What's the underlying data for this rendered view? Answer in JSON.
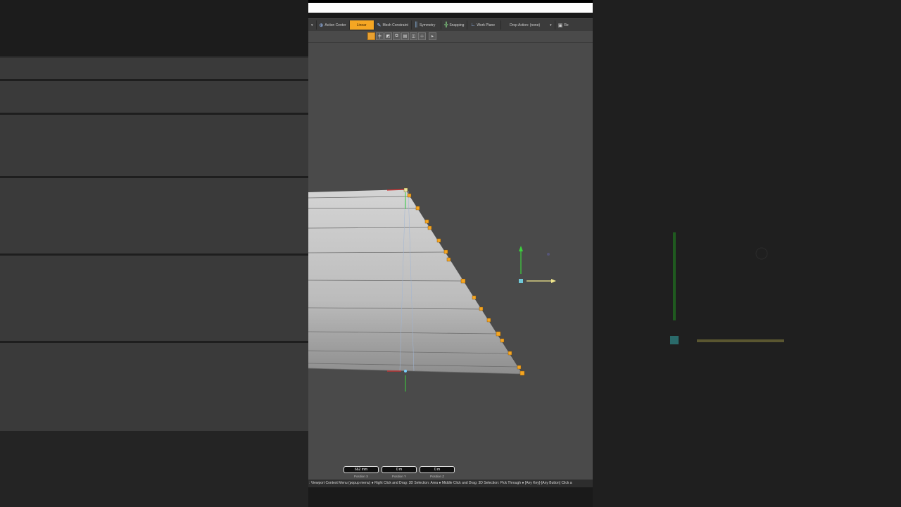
{
  "toolbar": {
    "items": [
      {
        "label": "Action Center",
        "icon": "action-center-icon"
      },
      {
        "label": "Linear",
        "icon": "",
        "active": true
      },
      {
        "label": "Mesh Constraint",
        "icon": "mesh-constraint-icon"
      },
      {
        "label": "Symmetry",
        "icon": "symmetry-icon"
      },
      {
        "label": "Snapping",
        "icon": "snapping-icon"
      },
      {
        "label": "Work Plane",
        "icon": "work-plane-icon"
      },
      {
        "label": "Drop Action: (none)",
        "icon": ""
      },
      {
        "label": "Re",
        "icon": "render-icon"
      }
    ],
    "accent": "#f5a623"
  },
  "fields": [
    {
      "value": "662 mm",
      "label": "Position X"
    },
    {
      "value": "0 m",
      "label": "Position Y"
    },
    {
      "value": "0 m",
      "label": "Position Z"
    }
  ],
  "status": {
    "text": ": Viewport Context Menu (popup menu) ● Right Click and Drag: 3D Selection: Area ● Middle Click and Drag: 3D Selection: Pick Through ● [Any Key]-[Any Button] Click a"
  },
  "colors": {
    "viewport_bg": "#4a4a4a",
    "mesh": "#c8c8c8",
    "vertex": "#f5a623",
    "axis_y": "#3cd23c",
    "axis_x": "#f0e68c"
  }
}
